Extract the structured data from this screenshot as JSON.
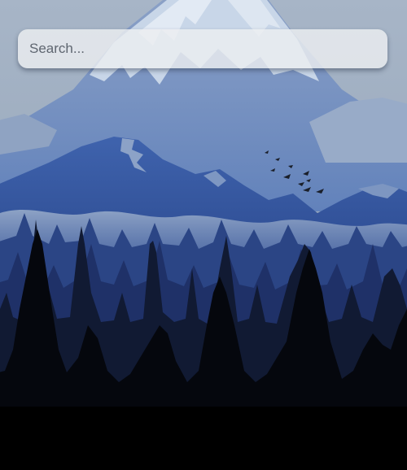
{
  "search": {
    "placeholder": "Search...",
    "value": ""
  },
  "background": {
    "description_icon": "mountain-forest-wallpaper",
    "colors": {
      "sky": "#9fb0c6",
      "snow": "#c9d6e6",
      "far_ridge": "#6f8fc0",
      "mid_ridge": "#3a5fa8",
      "near_ridge": "#2c4c94",
      "forest_far": "#2a3f78",
      "forest_mid": "#1b2a52",
      "forest_near": "#0b1020",
      "ground": "#000000",
      "birds": "#1a1f2a"
    }
  }
}
